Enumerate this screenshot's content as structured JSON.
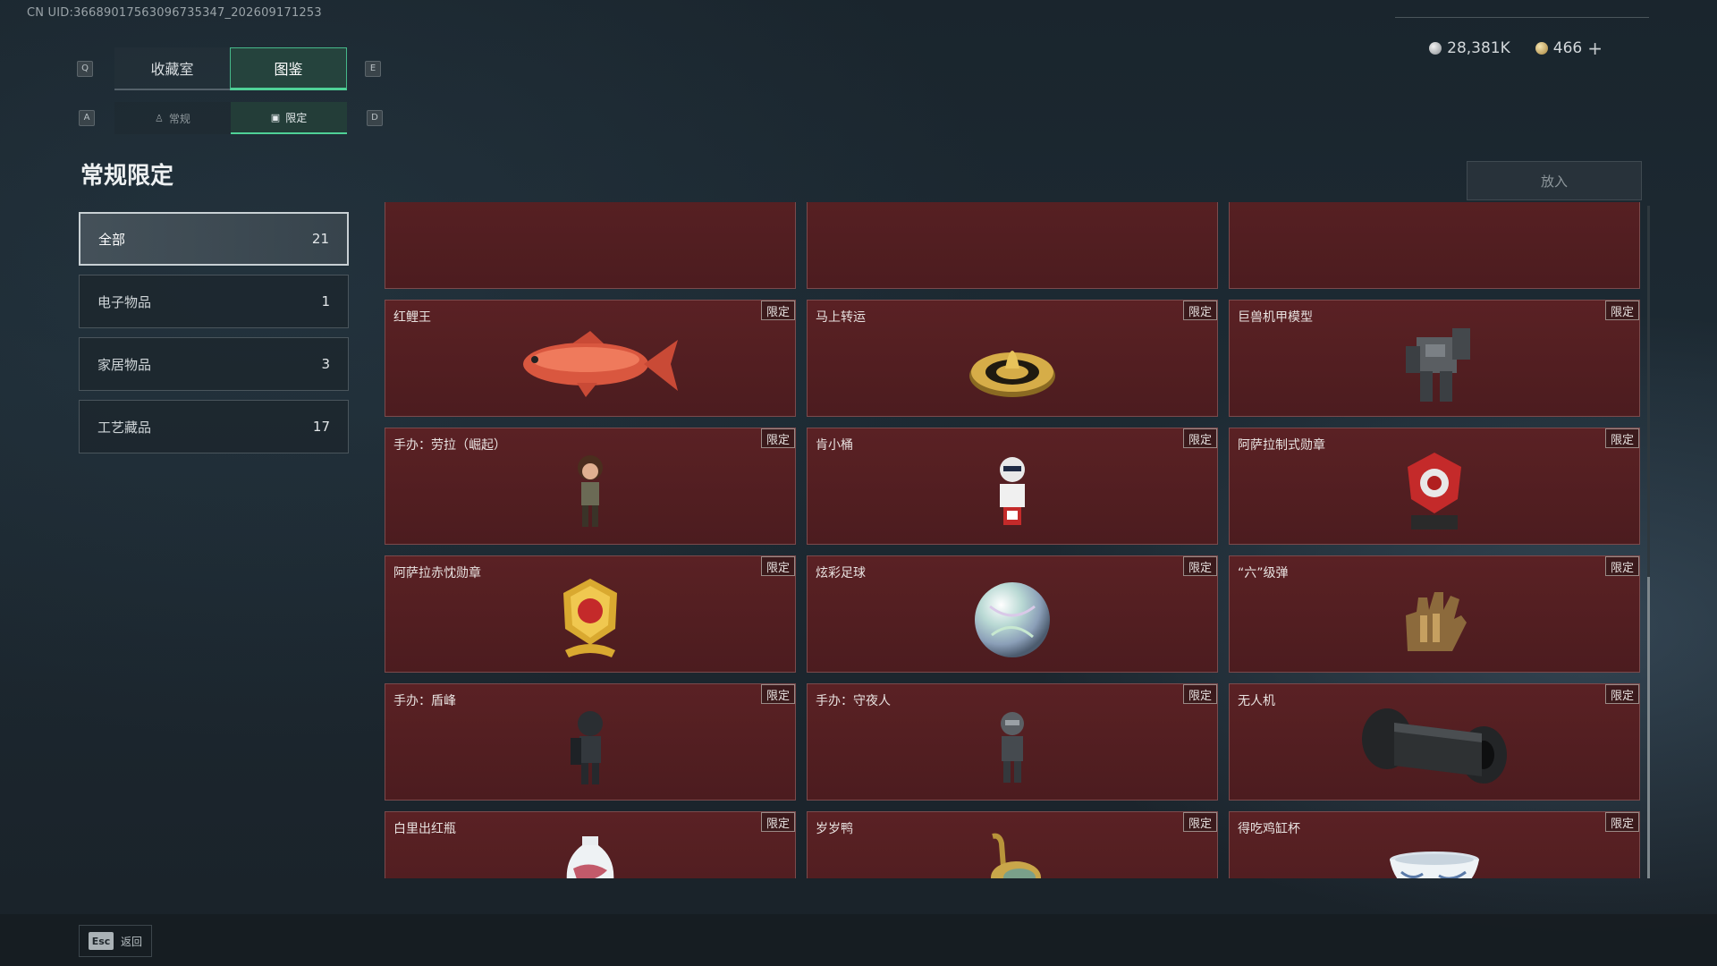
{
  "uid_text": "CN UID:366890175630967353​47_202609171253",
  "main_tabs": [
    {
      "label": "收藏室",
      "active": false
    },
    {
      "label": "图鉴",
      "active": true
    }
  ],
  "sub_tabs": [
    {
      "label": "常规",
      "active": false
    },
    {
      "label": "限定",
      "active": true
    }
  ],
  "key_hints": {
    "q": "Q",
    "e": "E",
    "a": "A",
    "d": "D"
  },
  "currency": {
    "silver": "28,381K",
    "gold": "466",
    "plus": "+"
  },
  "page_title": "常规限定",
  "put_button": "放入",
  "categories": [
    {
      "label": "全部",
      "count": "21",
      "active": true
    },
    {
      "label": "电子物品",
      "count": "1",
      "active": false
    },
    {
      "label": "家居物品",
      "count": "3",
      "active": false
    },
    {
      "label": "工艺藏品",
      "count": "17",
      "active": false
    }
  ],
  "tag_label": "限定",
  "items": [
    {
      "name": "",
      "icon": "partial-item-icon"
    },
    {
      "name": "",
      "icon": "partial-item-icon"
    },
    {
      "name": "",
      "icon": "partial-item-icon"
    },
    {
      "name": "红鲤王",
      "icon": "red-carp-icon"
    },
    {
      "name": "马上转运",
      "icon": "golden-wheel-icon"
    },
    {
      "name": "巨兽机甲模型",
      "icon": "mech-model-icon"
    },
    {
      "name": "手办：劳拉（崛起）",
      "icon": "lara-figure-icon"
    },
    {
      "name": "肯小桶",
      "icon": "bucket-figure-icon"
    },
    {
      "name": "阿萨拉制式勋章",
      "icon": "red-medal-icon"
    },
    {
      "name": "阿萨拉赤忱勋章",
      "icon": "gold-medal-icon"
    },
    {
      "name": "炫彩足球",
      "icon": "iridescent-ball-icon"
    },
    {
      "name": "“六”级弹",
      "icon": "bullet-hand-icon"
    },
    {
      "name": "手办：盾峰",
      "icon": "shield-figure-icon"
    },
    {
      "name": "手办：守夜人",
      "icon": "night-watch-figure-icon"
    },
    {
      "name": "无人机",
      "icon": "drone-roller-icon"
    },
    {
      "name": "白里出红瓶",
      "icon": "porcelain-vase-icon"
    },
    {
      "name": "岁岁鸭",
      "icon": "duck-statue-icon"
    },
    {
      "name": "得吃鸡缸杯",
      "icon": "porcelain-cup-icon"
    }
  ],
  "footer": {
    "esc_key": "Esc",
    "esc_label": "返回"
  }
}
